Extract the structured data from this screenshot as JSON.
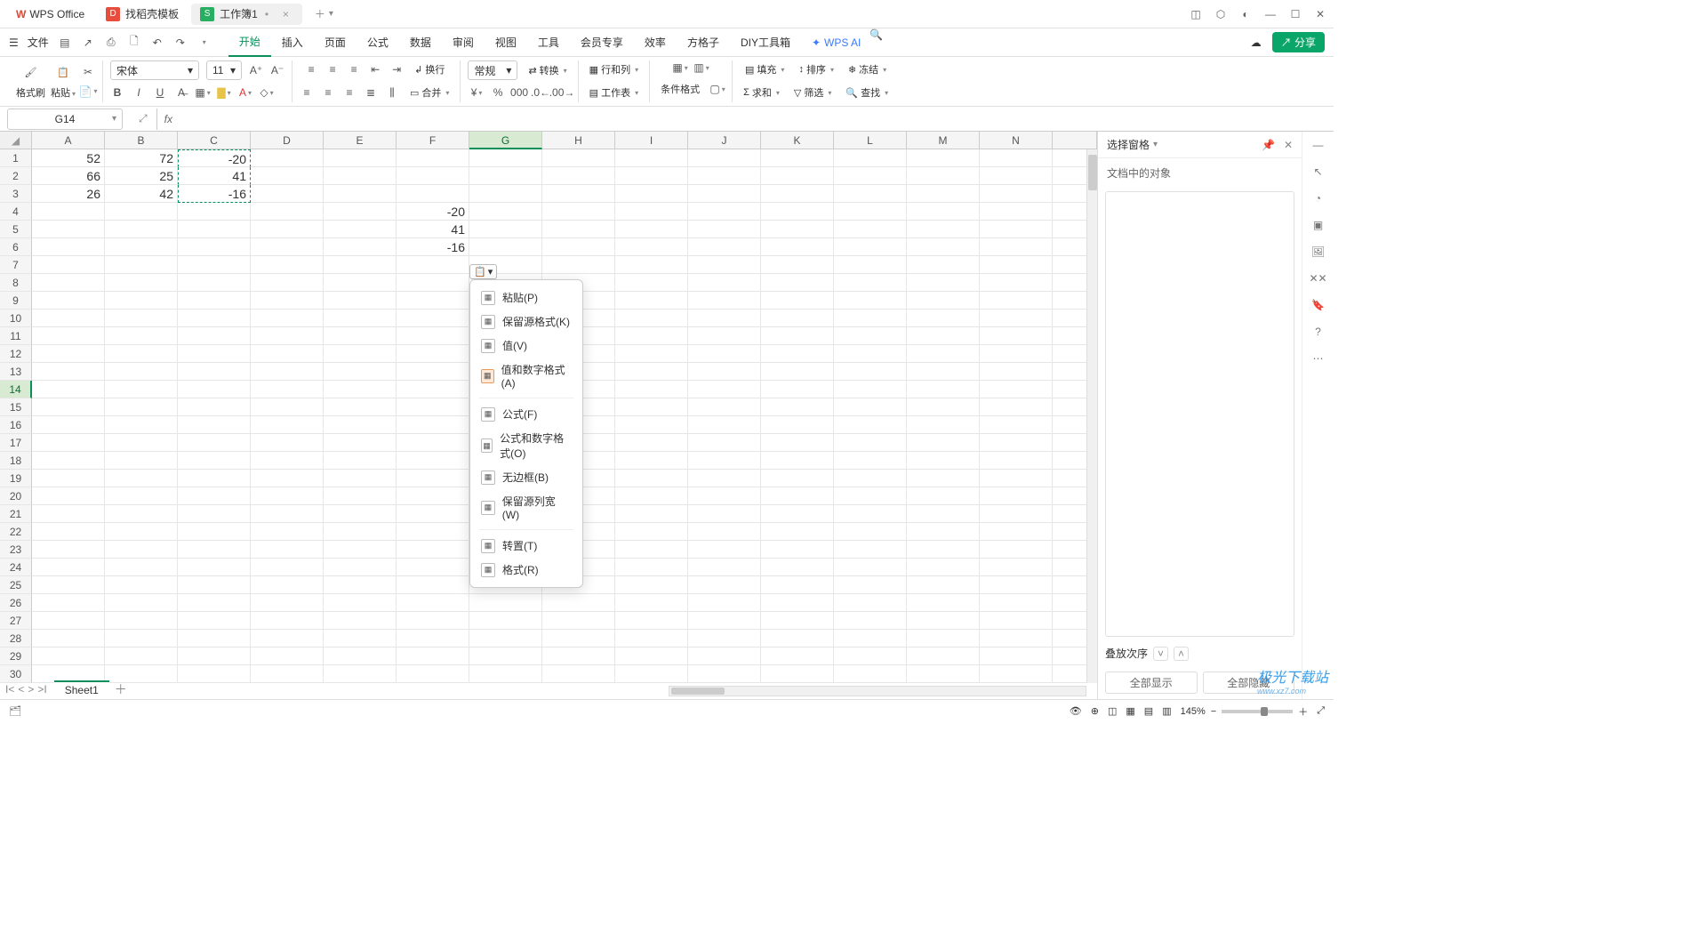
{
  "title_bar": {
    "tabs": [
      {
        "label": "WPS Office",
        "kind": "app"
      },
      {
        "label": "找稻壳模板",
        "kind": "template"
      },
      {
        "label": "工作簿1",
        "kind": "doc-active"
      }
    ]
  },
  "menu": {
    "file": "文件",
    "tabs": [
      "开始",
      "插入",
      "页面",
      "公式",
      "数据",
      "审阅",
      "视图",
      "工具",
      "会员专享",
      "效率",
      "方格子",
      "DIY工具箱"
    ],
    "active_tab": "开始",
    "ai": "WPS AI",
    "share": "分享"
  },
  "toolbar": {
    "format_painter": "格式刷",
    "paste": "粘贴",
    "font_name": "宋体",
    "font_size": "11",
    "number_format": "常规",
    "convert": "转换",
    "rowcol": "行和列",
    "worksheet": "工作表",
    "cond_fmt": "条件格式",
    "fill": "填充",
    "sort": "排序",
    "freeze": "冻结",
    "sum": "求和",
    "filter": "筛选",
    "find": "查找",
    "wrap": "换行",
    "merge": "合并"
  },
  "name_box": "G14",
  "columns": [
    "A",
    "B",
    "C",
    "D",
    "E",
    "F",
    "G",
    "H",
    "I",
    "J",
    "K",
    "L",
    "M",
    "N"
  ],
  "active_col_index": 6,
  "rows": 30,
  "active_row": 14,
  "cells": {
    "A1": "52",
    "B1": "72",
    "C1": "-20",
    "A2": "66",
    "B2": "25",
    "C2": "41",
    "A3": "26",
    "B3": "42",
    "C3": "-16",
    "F4": "-20",
    "F5": "41",
    "F6": "-16"
  },
  "marching_range": {
    "col_start": 2,
    "col_end": 2,
    "row_start": 1,
    "row_end": 3
  },
  "paste_menu": {
    "items": [
      {
        "label": "粘贴(P)"
      },
      {
        "label": "保留源格式(K)"
      },
      {
        "label": "值(V)"
      },
      {
        "label": "值和数字格式(A)",
        "hl": true
      },
      {
        "sep": true
      },
      {
        "label": "公式(F)"
      },
      {
        "label": "公式和数字格式(O)"
      },
      {
        "label": "无边框(B)"
      },
      {
        "label": "保留源列宽(W)"
      },
      {
        "sep": true
      },
      {
        "label": "转置(T)"
      },
      {
        "label": "格式(R)"
      }
    ]
  },
  "right_pane": {
    "title": "选择窗格",
    "subtitle": "文档中的对象",
    "order": "叠放次序",
    "show_all": "全部显示",
    "hide_all": "全部隐藏"
  },
  "sheet": {
    "name": "Sheet1"
  },
  "status": {
    "zoom": "145%"
  },
  "watermark": {
    "l1": "极光下载站",
    "l2": "www.xz7.com"
  }
}
